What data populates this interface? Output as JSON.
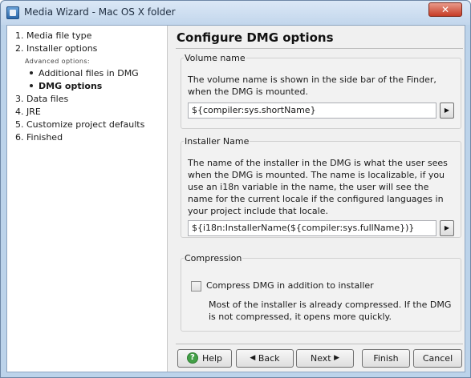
{
  "window": {
    "title": "Media Wizard - Mac OS X folder",
    "close_glyph": "✕"
  },
  "nav": {
    "items": [
      {
        "label": "1. Media file type"
      },
      {
        "label": "2. Installer options"
      },
      {
        "label": "3. Data files"
      },
      {
        "label": "4. JRE"
      },
      {
        "label": "5. Customize project defaults"
      },
      {
        "label": "6. Finished"
      }
    ],
    "advanced_header": "Advanced options:",
    "sub_items": [
      {
        "label": "Additional files in DMG",
        "current": false
      },
      {
        "label": "DMG options",
        "current": true
      }
    ]
  },
  "page": {
    "title": "Configure DMG options",
    "volume": {
      "label": "Volume name",
      "description": "The volume name is shown in the side bar of the Finder, when the DMG is mounted.",
      "value": "${compiler:sys.shortName}"
    },
    "installer": {
      "label": "Installer Name",
      "description": "The name of the installer in the DMG is what the user sees when the DMG is mounted. The name is localizable, if you use an i18n variable in the name, the user will see the name for the current locale if the configured languages in your project include that locale.",
      "value": "${i18n:InstallerName(${compiler:sys.fullName})}"
    },
    "compression": {
      "label": "Compression",
      "checkbox_label": "Compress DMG in addition to installer",
      "checked": false,
      "description": "Most of the installer is already compressed. If the DMG is not compressed, it opens more quickly."
    }
  },
  "buttons": {
    "help": "Help",
    "back": "Back",
    "next": "Next",
    "finish": "Finish",
    "cancel": "Cancel"
  }
}
